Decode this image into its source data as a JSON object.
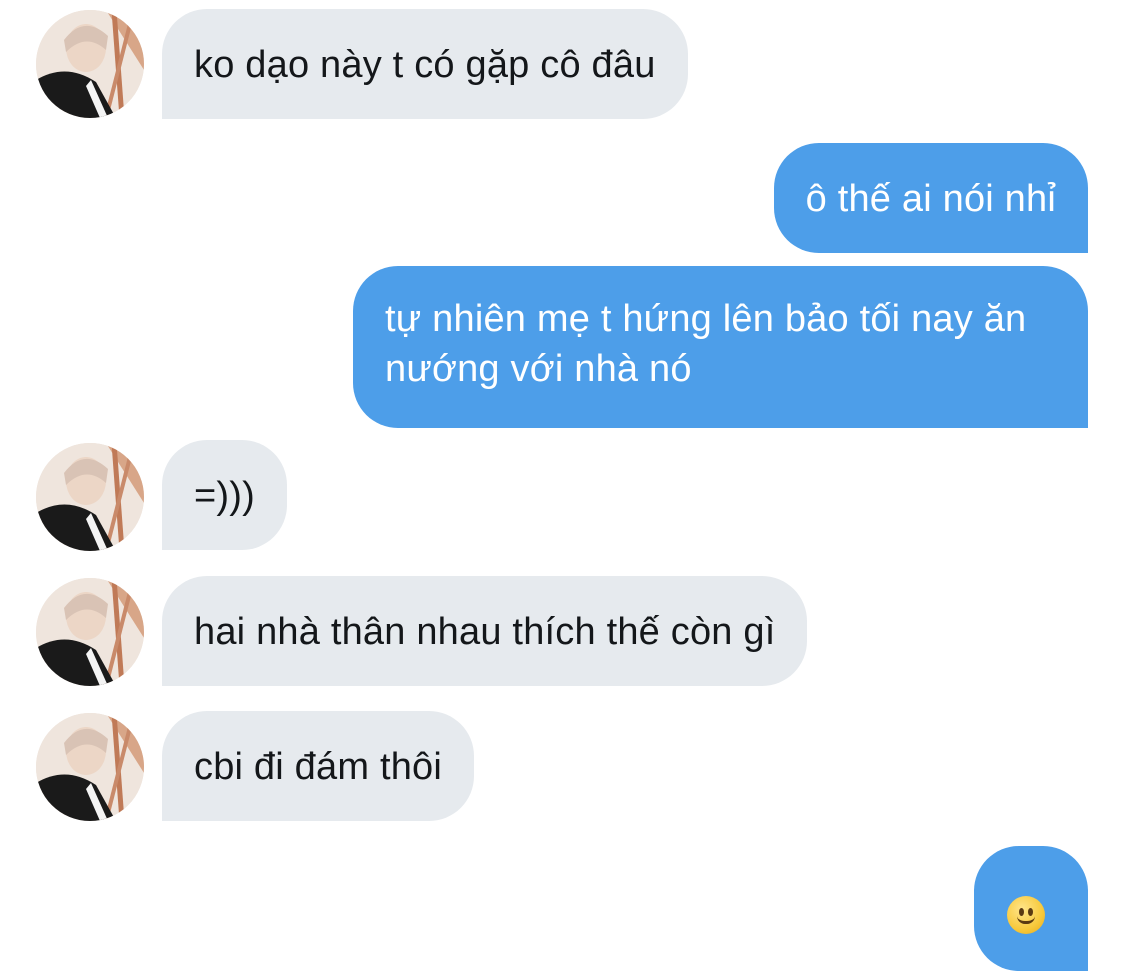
{
  "messages": [
    {
      "direction": "incoming",
      "text": "ko dạo này t có gặp cô đâu",
      "avatar": "contact-avatar"
    },
    {
      "direction": "outgoing",
      "text": "ô thế ai nói nhỉ"
    },
    {
      "direction": "outgoing",
      "text": "tự nhiên mẹ t hứng lên bảo tối nay ăn nướng với nhà nó"
    },
    {
      "direction": "incoming",
      "text": "=)))",
      "avatar": "contact-avatar"
    },
    {
      "direction": "incoming",
      "text": "hai nhà thân nhau thích thế còn gì",
      "avatar": "contact-avatar"
    },
    {
      "direction": "incoming",
      "text": "cbi đi đám thôi",
      "avatar": "contact-avatar"
    },
    {
      "direction": "outgoing",
      "text": "",
      "emoji": "slightly-smiling-face-emoji"
    }
  ],
  "colors": {
    "incoming_bubble": "#e6eaee",
    "outgoing_bubble": "#4d9ee9",
    "incoming_text": "#14171a",
    "outgoing_text": "#ffffff"
  }
}
